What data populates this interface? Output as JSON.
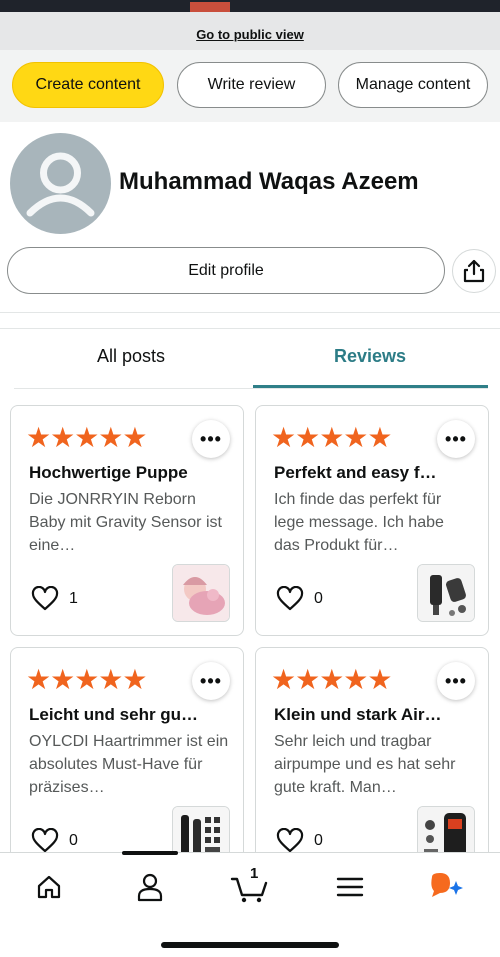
{
  "header": {
    "public_view_link": "Go to public view"
  },
  "actions": {
    "create_content": "Create content",
    "write_review": "Write review",
    "manage_content": "Manage content"
  },
  "profile": {
    "name": "Muhammad Waqas Azeem",
    "edit_label": "Edit profile"
  },
  "tabs": {
    "all_posts": "All posts",
    "reviews": "Reviews",
    "active": "reviews"
  },
  "reviews": [
    {
      "rating": 5,
      "title": "Hochwertige Puppe",
      "body": "Die JONRRYIN Reborn Baby mit Gravity Sensor ist eine…",
      "likes": "1",
      "image_icon": "doll-image"
    },
    {
      "rating": 5,
      "title": "Perfekt and easy f…",
      "body": "Ich finde das perfekt für lege message. Ich habe das Produkt für…",
      "likes": "0",
      "image_icon": "massage-gun-image"
    },
    {
      "rating": 5,
      "title": "Leicht und sehr gu…",
      "body": "OYLCDI Haartrimmer ist ein absolutes Must-Have für präzises…",
      "likes": "0",
      "image_icon": "hair-trimmer-kit-image"
    },
    {
      "rating": 5,
      "title": "Klein und stark Air…",
      "body": "Sehr leich und tragbar airpumpe und es hat sehr gute kraft. Man…",
      "likes": "0",
      "image_icon": "air-pump-image"
    }
  ],
  "bottom_nav": {
    "cart_count": "1",
    "icons": [
      "home-icon",
      "account-icon",
      "cart-icon",
      "menu-icon",
      "ai-assistant-icon"
    ]
  },
  "colors": {
    "create_button": "#ffd814",
    "star": "#f0641e",
    "active_tab": "#2c7c86",
    "assistant_orange": "#f66a1e",
    "assistant_blue": "#1a73e8"
  }
}
